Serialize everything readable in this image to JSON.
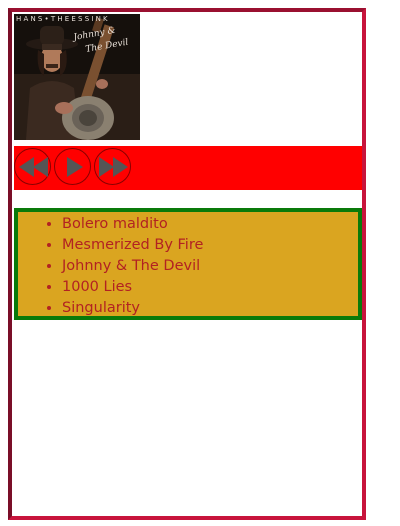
{
  "album": {
    "cover_text": "HANS•THEESSINK",
    "cover_script": "Johnny & The Devil",
    "cover_script_line1": "Johnny &",
    "cover_script_line2": "The Devil"
  },
  "controls": {
    "prev_icon": "previous-icon",
    "play_icon": "play-icon",
    "next_icon": "next-icon"
  },
  "playlist": {
    "tracks": [
      "Bolero maldito",
      "Mesmerized By Fire",
      "Johnny & The Devil",
      "1000 Lies",
      "Singularity"
    ]
  },
  "colors": {
    "frame": "#c8143c",
    "controls_bg": "#ff0000",
    "playlist_bg": "#daa520",
    "playlist_border": "#0a7a0a",
    "track_text": "#b22222",
    "icon": "#555555"
  }
}
